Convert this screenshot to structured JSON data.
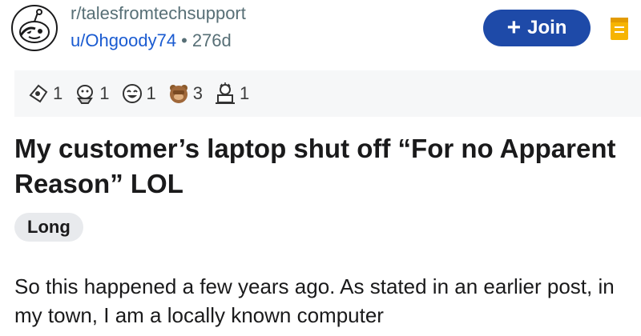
{
  "header": {
    "subreddit": "r/talesfromtechsupport",
    "username": "u/Ohgoody74",
    "separator": "•",
    "age": "276d",
    "join_label": "Join",
    "join_icon": "plus-icon",
    "save_icon": "bookmark-icon",
    "avatar_icon": "reddit-snoo-facepalm-icon"
  },
  "awards": [
    {
      "icon": "helpful-award-icon",
      "count": "1"
    },
    {
      "icon": "wholesome-seal-award-icon",
      "count": "1"
    },
    {
      "icon": "laughing-face-award-icon",
      "count": "1"
    },
    {
      "icon": "bear-facepalm-award-icon",
      "count": "3"
    },
    {
      "icon": "frustrated-laptop-award-icon",
      "count": "1"
    }
  ],
  "post": {
    "title": "My customer’s laptop shut off “For no Apparent Reason” LOL",
    "flair": "Long",
    "body": "So this happened a few years ago. As stated in an earlier post, in my town, I am a locally known computer"
  },
  "colors": {
    "join_bg": "#1e4aa8",
    "username": "#1a5bd1",
    "muted": "#576f76",
    "awards_bg": "#f6f7f8",
    "flair_bg": "#e8eaed"
  }
}
